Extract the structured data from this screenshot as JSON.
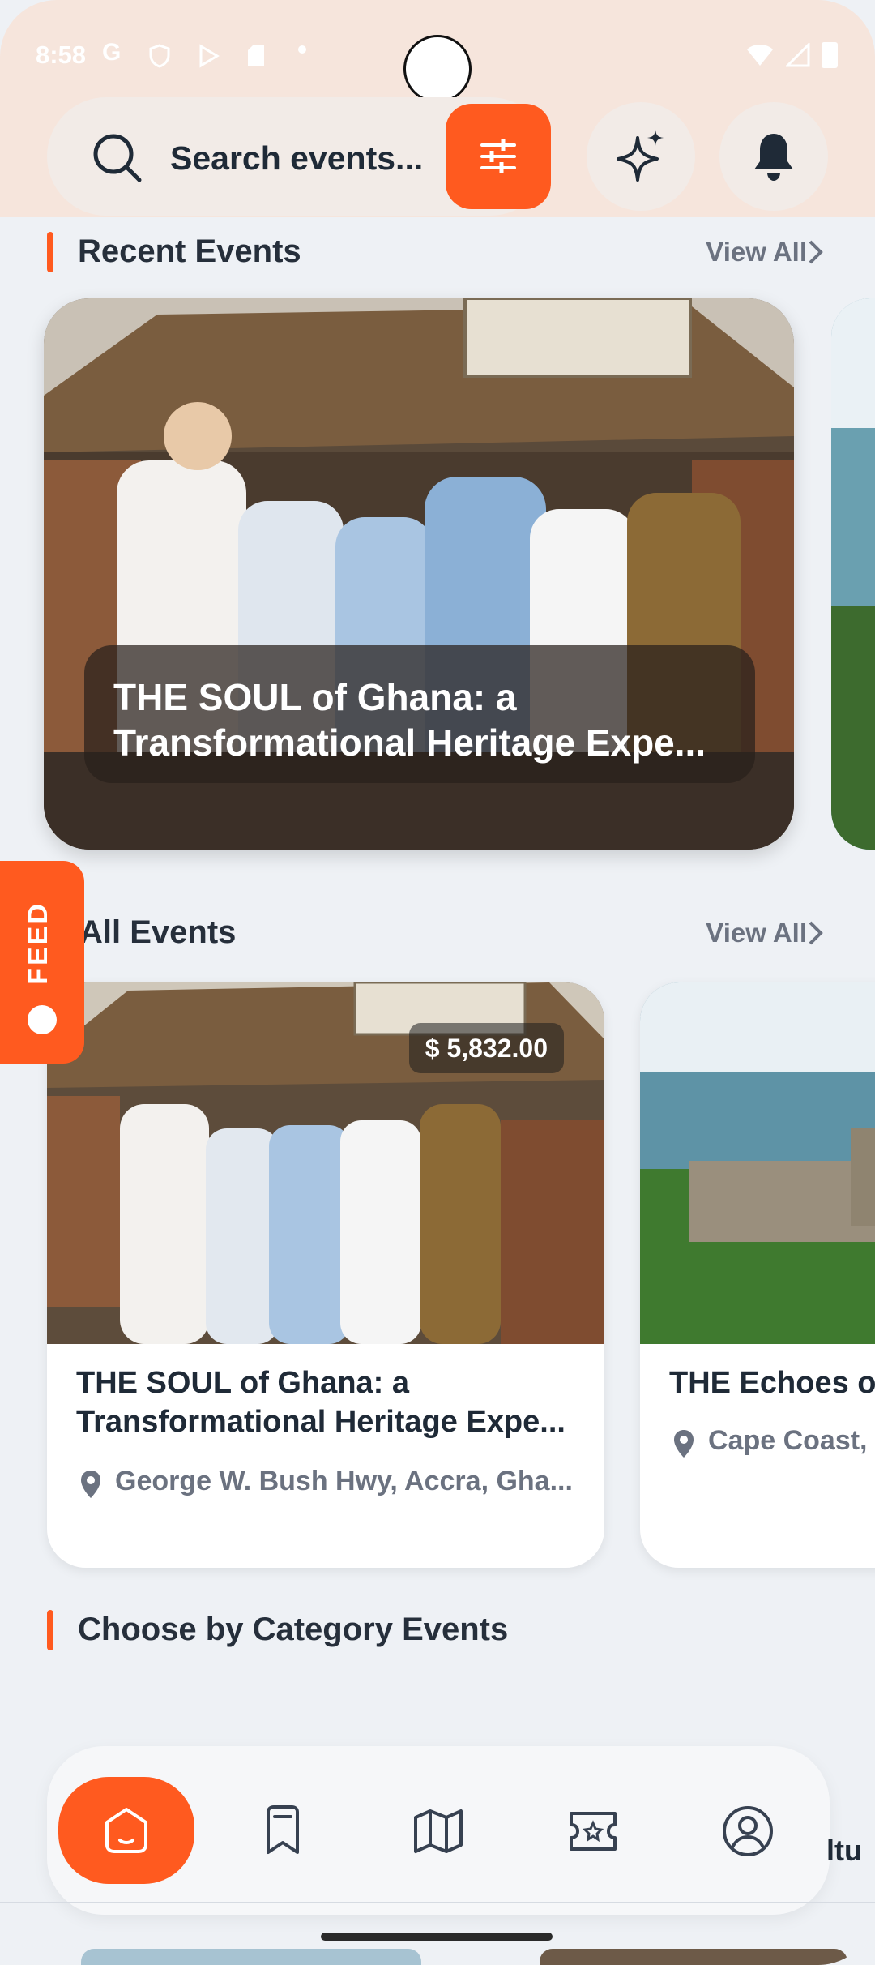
{
  "status_bar": {
    "time": "8:58",
    "left_icons": [
      "google-icon",
      "shield-icon",
      "play-icon",
      "sd-card-icon",
      "dot-icon"
    ],
    "right_icons": [
      "wifi-icon",
      "signal-icon",
      "battery-icon"
    ]
  },
  "header": {
    "search_placeholder": "Search events...",
    "buttons": [
      "filter-icon",
      "sparkle-icon",
      "bell-icon"
    ]
  },
  "recent_section": {
    "title": "Recent Events",
    "view_all": "View All",
    "card": {
      "title_line1": "THE SOUL of Ghana: a",
      "title_line2": "Transformational Heritage Expe..."
    }
  },
  "all_section": {
    "title": "All Events",
    "view_all": "View All",
    "cards": [
      {
        "price": "$ 5,832.00",
        "title_line1": "THE SOUL of Ghana: a",
        "title_line2": "Transformational Heritage Expe...",
        "location": "George W. Bush Hwy, Accra, Gha..."
      },
      {
        "title_line1": "THE Echoes of",
        "location": "Cape Coast,"
      }
    ]
  },
  "feed_tab": {
    "label": "FEED"
  },
  "category_section": {
    "title": "Choose by Category Events"
  },
  "bottom_nav": {
    "items": [
      "home-icon",
      "bookmark-icon",
      "map-icon",
      "ticket-icon",
      "profile-icon"
    ],
    "active": "home-icon",
    "peek_text": "ltu"
  },
  "colors": {
    "accent": "#ff5a1f",
    "header_bg": "#f6e5dc",
    "page_bg": "#eef1f5"
  }
}
